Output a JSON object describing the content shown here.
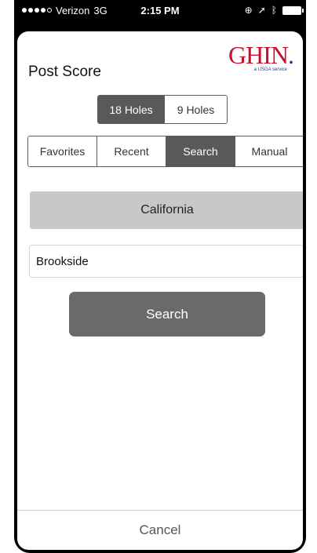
{
  "status_bar": {
    "carrier": "Verizon",
    "network": "3G",
    "time": "2:15 PM"
  },
  "header": {
    "title": "Post Score",
    "logo_text": "GHIN",
    "logo_dot": ".",
    "logo_subtitle": "a USGA service"
  },
  "holes_toggle": {
    "options": [
      "18 Holes",
      "9 Holes"
    ],
    "selected": "18 Holes"
  },
  "tabs": {
    "items": [
      "Favorites",
      "Recent",
      "Search",
      "Manual"
    ],
    "selected": "Search"
  },
  "search_form": {
    "state_label": "California",
    "course_value": "Brookside",
    "search_label": "Search"
  },
  "footer": {
    "cancel_label": "Cancel"
  },
  "colors": {
    "accent_gray": "#595959",
    "logo_red": "#c8102e",
    "logo_blue": "#1f3a93"
  }
}
